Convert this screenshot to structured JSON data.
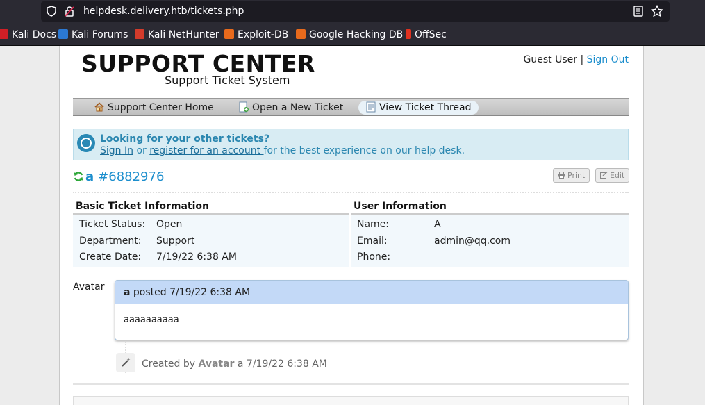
{
  "browser": {
    "url": "helpdesk.delivery.htb/tickets.php",
    "bookmarks": [
      {
        "label": "Kali Docs",
        "color": "#d11f26"
      },
      {
        "label": "Kali Forums",
        "color": "#2b78d3"
      },
      {
        "label": "Kali NetHunter",
        "color": "#d33b2b"
      },
      {
        "label": "Exploit-DB",
        "color": "#e86a1c"
      },
      {
        "label": "Google Hacking DB",
        "color": "#e86a1c"
      },
      {
        "label": "OffSec",
        "color": "#e0311f"
      }
    ]
  },
  "header": {
    "title": "SUPPORT CENTER",
    "subtitle": "Support Ticket System",
    "user": "Guest User",
    "separator": "|",
    "sign_out": "Sign Out"
  },
  "nav": {
    "items": [
      {
        "label": "Support Center Home",
        "icon": "home-icon"
      },
      {
        "label": "Open a New Ticket",
        "icon": "new-ticket-icon"
      },
      {
        "label": "View Ticket Thread",
        "icon": "ticket-thread-icon",
        "active": true
      }
    ]
  },
  "notice": {
    "heading": "Looking for your other tickets?",
    "sign_in": "Sign In",
    "or": " or ",
    "register": "register for an account ",
    "rest": "for the best experience on our help desk."
  },
  "ticket": {
    "subject": "a",
    "number": "#6882976",
    "print_label": "Print",
    "edit_label": "Edit"
  },
  "basic_info": {
    "heading": "Basic Ticket Information",
    "rows": [
      {
        "key": "Ticket Status:",
        "value": "Open"
      },
      {
        "key": "Department:",
        "value": "Support"
      },
      {
        "key": "Create Date:",
        "value": "7/19/22 6:38 AM"
      }
    ]
  },
  "user_info": {
    "heading": "User Information",
    "rows": [
      {
        "key": "Name:",
        "value": "A"
      },
      {
        "key": "Email:",
        "value": "admin@qq.com"
      },
      {
        "key": "Phone:",
        "value": ""
      }
    ]
  },
  "thread": {
    "avatar_label": "Avatar",
    "poster": "a",
    "posted_text": " posted 7/19/22 6:38 AM",
    "message": "aaaaaaaaaa"
  },
  "event": {
    "created_by": "Created by ",
    "who": "Avatar",
    "when": " a 7/19/22 6:38 AM"
  },
  "colors": {
    "link": "#1c8ecd",
    "notice_bg": "#d8ecf3",
    "thread_header_bg": "#c3d9f7"
  }
}
